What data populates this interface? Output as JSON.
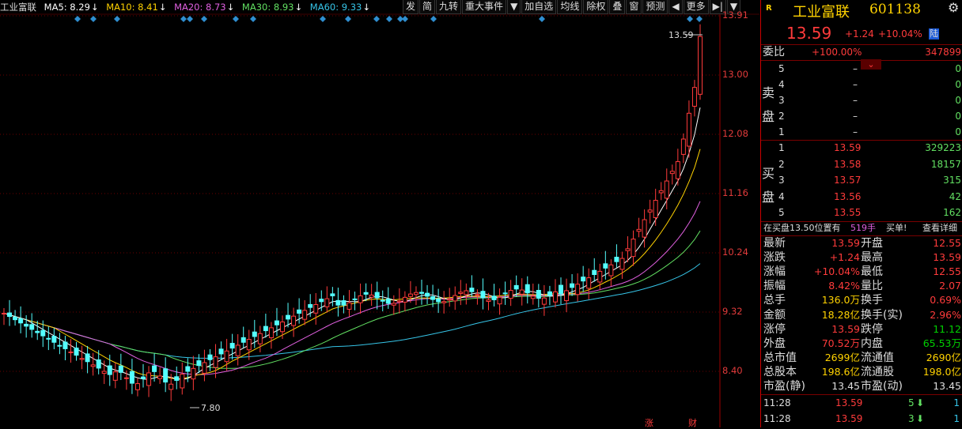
{
  "stock": {
    "name": "工业富联",
    "code": "601138",
    "price": "13.59",
    "change": "+1.24",
    "pct": "+10.04%",
    "tag": "陆",
    "r_badge": "R"
  },
  "ma_legend": [
    {
      "label": "工业富联",
      "color": "#dddddd"
    },
    {
      "label": "MA5: 8.29",
      "color": "#ffffff"
    },
    {
      "label": "MA10: 8.41",
      "color": "#ffd200"
    },
    {
      "label": "MA20: 8.73",
      "color": "#e060e0"
    },
    {
      "label": "MA30: 8.93",
      "color": "#62e062"
    },
    {
      "label": "MA60: 9.33",
      "color": "#36c5e8"
    }
  ],
  "toolbar": [
    "发",
    "简",
    "九转",
    "重大事件",
    "▼",
    "加自选",
    "均线",
    "除权",
    "叠",
    "窗",
    "预测",
    "◀",
    "更多",
    "▶|",
    "▼"
  ],
  "y_labels": [
    "13.91",
    "13.00",
    "12.08",
    "11.16",
    "10.24",
    "9.32",
    "8.40"
  ],
  "annotations": {
    "high": "13.59",
    "low": "7.80",
    "bottom_marks": [
      "涨",
      "财"
    ]
  },
  "weibi": {
    "label": "委比",
    "pct": "+100.00%",
    "diff": "347899"
  },
  "sell": {
    "label1": "卖",
    "label2": "盘",
    "rows": [
      [
        "5",
        "–",
        "0"
      ],
      [
        "4",
        "–",
        "0"
      ],
      [
        "3",
        "–",
        "0"
      ],
      [
        "2",
        "–",
        "0"
      ],
      [
        "1",
        "–",
        "0"
      ]
    ]
  },
  "buy": {
    "label1": "买",
    "label2": "盘",
    "rows": [
      [
        "1",
        "13.59",
        "329223"
      ],
      [
        "2",
        "13.58",
        "18157"
      ],
      [
        "3",
        "13.57",
        "315"
      ],
      [
        "4",
        "13.56",
        "42"
      ],
      [
        "5",
        "13.55",
        "162"
      ]
    ]
  },
  "notice": {
    "text": "在买盘13.50位置有",
    "qty": "519手",
    "act": "买单!",
    "link": "查看详细"
  },
  "stats": [
    [
      "最新",
      "13.59",
      "开盘",
      "12.55"
    ],
    [
      "涨跌",
      "+1.24",
      "最高",
      "13.59"
    ],
    [
      "涨幅",
      "+10.04%",
      "最低",
      "12.55"
    ],
    [
      "振幅",
      "8.42%",
      "量比",
      "2.07"
    ],
    [
      "总手",
      "136.0万",
      "换手",
      "0.69%"
    ],
    [
      "金额",
      "18.28亿",
      "换手(实)",
      "2.96%"
    ],
    [
      "涨停",
      "13.59",
      "跌停",
      "11.12"
    ],
    [
      "外盘",
      "70.52万",
      "内盘",
      "65.53万"
    ],
    [
      "总市值",
      "2699亿",
      "流通值",
      "2690亿"
    ],
    [
      "总股本",
      "198.6亿",
      "流通股",
      "198.0亿"
    ],
    [
      "市盈(静)",
      "13.45",
      "市盈(动)",
      "13.45"
    ]
  ],
  "ticks": [
    [
      "11:28",
      "13.59",
      "5",
      "1"
    ],
    [
      "11:28",
      "13.59",
      "3",
      "1"
    ]
  ]
}
